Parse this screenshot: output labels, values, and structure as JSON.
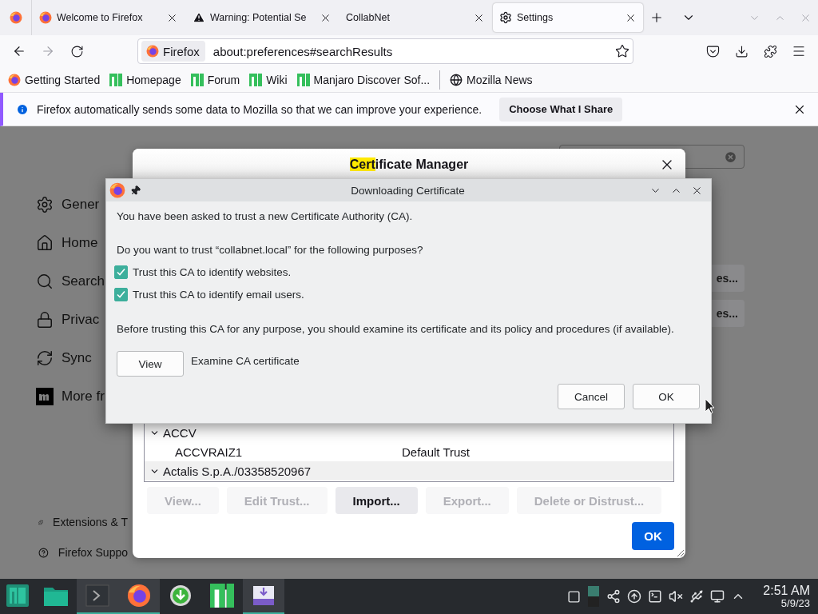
{
  "tabs": [
    {
      "label": "Welcome to Firefox",
      "kind": "firefox",
      "selected": false
    },
    {
      "label": "Warning: Potential Se",
      "kind": "warning",
      "selected": false
    },
    {
      "label": "CollabNet",
      "kind": "plain",
      "selected": false
    },
    {
      "label": "Settings",
      "kind": "gear",
      "selected": true
    }
  ],
  "toolbar": {
    "identity": "Firefox",
    "url": "about:preferences#searchResults"
  },
  "bookmarks": [
    {
      "label": "Getting Started",
      "kind": "firefox"
    },
    {
      "label": "Homepage",
      "kind": "manjaro"
    },
    {
      "label": "Forum",
      "kind": "manjaro"
    },
    {
      "label": "Wiki",
      "kind": "manjaro"
    },
    {
      "label": "Manjaro Discover Sof...",
      "kind": "manjaro"
    }
  ],
  "other_bookmarks": [
    {
      "label": "Mozilla News",
      "kind": "globe"
    }
  ],
  "notification": {
    "message": "Firefox automatically sends some data to Mozilla so that we can improve your experience.",
    "action": "Choose What I Share"
  },
  "settings": {
    "nav": [
      {
        "label": "Gener",
        "kind": "gear"
      },
      {
        "label": "Home",
        "kind": "home"
      },
      {
        "label": "Search",
        "kind": "search"
      },
      {
        "label": "Privac",
        "kind": "lock"
      },
      {
        "label": "Sync",
        "kind": "sync"
      },
      {
        "label": "More fr",
        "kind": "mozilla"
      }
    ],
    "footer": [
      {
        "label": "Extensions & T",
        "kind": "puzzle"
      },
      {
        "label": "Firefox Suppo",
        "kind": "help"
      }
    ],
    "buttons": [
      "es...",
      "es..."
    ]
  },
  "cert_manager": {
    "title_parts": [
      {
        "text": "Cert",
        "highlighted": true
      },
      {
        "text": "ificate Manager",
        "highlighted": false
      }
    ],
    "tree": [
      {
        "label": "ACCV",
        "expanded": true,
        "children": [
          {
            "name": "ACCVRAIZ1",
            "trust": "Default Trust"
          }
        ]
      },
      {
        "label": "Actalis S.p.A./03358520967",
        "expanded": true
      }
    ],
    "buttons": [
      {
        "label": "View...",
        "disabled": true
      },
      {
        "label": "Edit Trust...",
        "disabled": true
      },
      {
        "label": "Import...",
        "disabled": false
      },
      {
        "label": "Export...",
        "disabled": true
      },
      {
        "label": "Delete or Distrust...",
        "disabled": true
      }
    ],
    "ok": "OK"
  },
  "download_dialog": {
    "title": "Downloading Certificate",
    "intro": "You have been asked to trust a new Certificate Authority (CA).",
    "question": "Do you want to trust “collabnet.local” for the following purposes?",
    "options": [
      {
        "label": "Trust this CA to identify websites.",
        "checked": true
      },
      {
        "label": "Trust this CA to identify email users.",
        "checked": true
      }
    ],
    "warning": "Before trusting this CA for any purpose, you should examine its certificate and its policy and procedures (if available).",
    "view_button": "View",
    "view_label": "Examine CA certificate",
    "buttons": [
      "Cancel",
      "OK"
    ]
  },
  "taskbar": {
    "apps": [
      {
        "kind": "launcher",
        "active": false
      },
      {
        "kind": "folder",
        "active": false
      },
      {
        "kind": "terminal",
        "active": true
      },
      {
        "kind": "firefox",
        "active": true
      },
      {
        "kind": "downloader",
        "active": false
      },
      {
        "kind": "manjaro",
        "active": false
      },
      {
        "kind": "installer",
        "active": true
      }
    ],
    "time": "2:51 AM",
    "date": "5/9/23"
  }
}
